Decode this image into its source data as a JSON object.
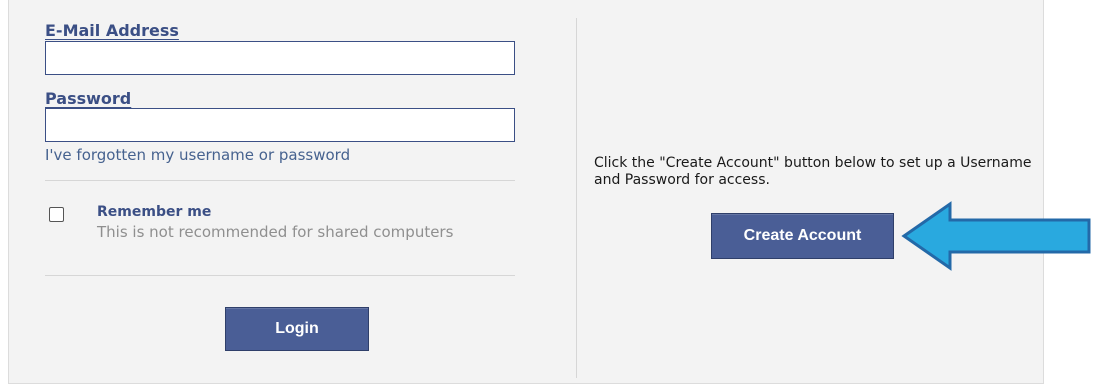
{
  "login": {
    "email_label": "E-Mail Address",
    "email_value": "",
    "password_label": "Password",
    "password_value": "",
    "forgot_link": "I've forgotten my username or password",
    "remember_label": "Remember me",
    "remember_hint": "This is not recommended for shared computers",
    "remember_checked": false,
    "login_button": "Login"
  },
  "register": {
    "instruction": "Click the \"Create Account\" button below to set up a Username and Password for access.",
    "create_button": "Create Account"
  },
  "colors": {
    "button_bg": "#4a5e96",
    "label": "#3b4f85",
    "panel_bg": "#f3f3f3",
    "arrow": "#29a9df"
  },
  "icons": {
    "callout": "left-arrow-icon"
  }
}
